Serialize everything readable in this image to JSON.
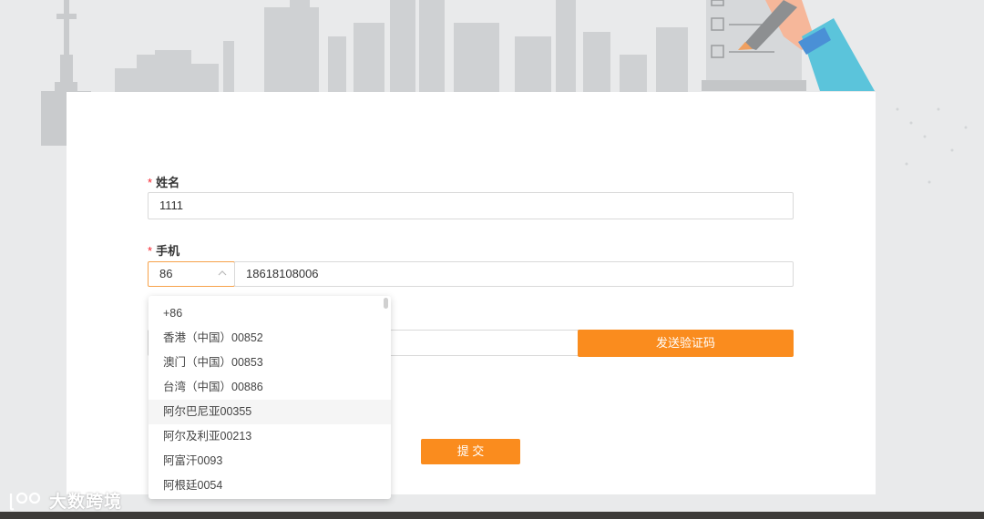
{
  "form": {
    "name_label": "姓名",
    "name_required": "*",
    "name_value": "1111",
    "phone_label": "手机",
    "phone_required": "*",
    "country_code_selected": "86",
    "phone_value": "18618108006",
    "send_code_label": "发送验证码",
    "submit_label": "提 交"
  },
  "dropdown": {
    "options": [
      "+86",
      "香港（中国）00852",
      "澳门（中国）00853",
      "台湾（中国）00886",
      "阿尔巴尼亚00355",
      "阿尔及利亚00213",
      "阿富汗0093",
      "阿根廷0054"
    ],
    "hovered_index": 4
  },
  "watermark": {
    "text": "大数跨境"
  },
  "colors": {
    "accent": "#fa8c1e",
    "required": "#f5222d",
    "focus_border": "#f7a24a"
  }
}
